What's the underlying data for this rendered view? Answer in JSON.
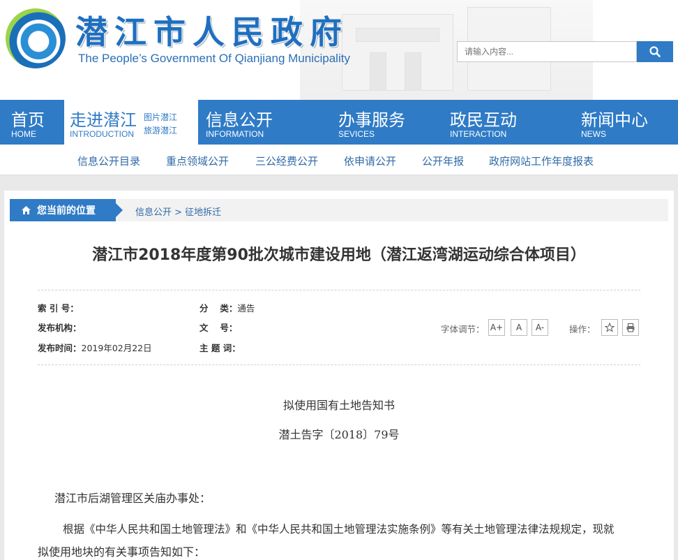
{
  "header": {
    "site_title": "潜江市人民政府",
    "site_subtitle": "The People’s Government Of Qianjiang Municipality",
    "search_placeholder": "请输入内容..."
  },
  "nav": {
    "items": [
      {
        "cn": "首页",
        "en": "HOME"
      },
      {
        "cn": "走进潜江",
        "en": "INTRODUCTION",
        "sub": [
          "图片潜江",
          "旅游潜江"
        ]
      },
      {
        "cn": "信息公开",
        "en": "INFORMATION"
      },
      {
        "cn": "办事服务",
        "en": "SEVICES"
      },
      {
        "cn": "政民互动",
        "en": "INTERACTION"
      },
      {
        "cn": "新闻中心",
        "en": "NEWS"
      }
    ]
  },
  "subnav": {
    "items": [
      "信息公开目录",
      "重点领域公开",
      "三公经费公开",
      "依申请公开",
      "公开年报",
      "政府网站工作年度报表"
    ]
  },
  "breadcrumb": {
    "label": "您当前的位置",
    "path": "信息公开 > 征地拆迁"
  },
  "article": {
    "title": "潜江市2018年度第90批次城市建设用地（潜江返湾湖运动综合体项目）",
    "meta": {
      "index_label": "索 引 号：",
      "index_value": "",
      "category_label": "分　 类：",
      "category_value": "通告",
      "publisher_label": "发布机构：",
      "publisher_value": "",
      "docno_label": "文　 号：",
      "docno_value": "",
      "date_label": "发布时间：",
      "date_value": "2019年02月22日",
      "subject_label": "主 题 词：",
      "subject_value": ""
    },
    "tools": {
      "font_label": "字体调节：",
      "font_up": "A+",
      "font_normal": "A",
      "font_down": "A-",
      "ops_label": "操作："
    },
    "doc_heading": "拟使用国有土地告知书",
    "doc_number": "潜土告字〔2018〕79号",
    "recipient": "潜江市后湖管理区关庙办事处：",
    "para1_line1": "根据《中华人民共和国土地管理法》和《中华人民共和国土地管理法实施条例》等有关土地管理法律法规规定，现就",
    "para1_line2": "拟使用地块的有关事项告知如下："
  }
}
